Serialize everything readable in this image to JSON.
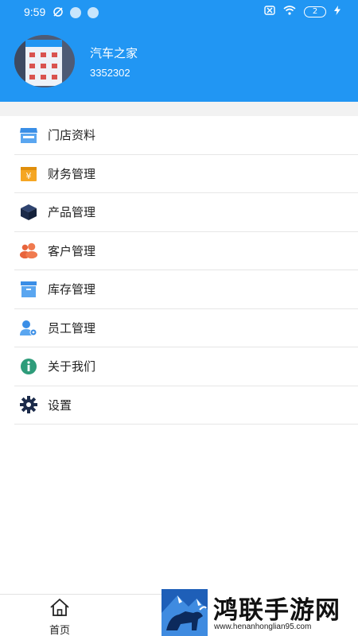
{
  "status_bar": {
    "time": "9:59",
    "battery": "2"
  },
  "profile": {
    "name": "汽车之家",
    "id": "3352302"
  },
  "menu": [
    {
      "label": "门店资料",
      "icon": "store-icon",
      "color": "#3a8ee6"
    },
    {
      "label": "财务管理",
      "icon": "finance-icon",
      "color": "#f5a623"
    },
    {
      "label": "产品管理",
      "icon": "product-box-icon",
      "color": "#1c2b4a"
    },
    {
      "label": "客户管理",
      "icon": "customers-icon",
      "color": "#e8643c"
    },
    {
      "label": "库存管理",
      "icon": "inventory-icon",
      "color": "#3a8ee6"
    },
    {
      "label": "员工管理",
      "icon": "employees-icon",
      "color": "#3a8ee6"
    },
    {
      "label": "关于我们",
      "icon": "info-icon",
      "color": "#2e9c7a"
    },
    {
      "label": "设置",
      "icon": "settings-gear-icon",
      "color": "#1c2b4a"
    }
  ],
  "tabbar": {
    "home_label": "首页"
  },
  "watermark": {
    "title": "鸿联手游网",
    "url": "www.henanhonglian95.com"
  },
  "colors": {
    "header": "#2196F3",
    "background": "#ffffff",
    "divider": "#e6e6e6"
  }
}
